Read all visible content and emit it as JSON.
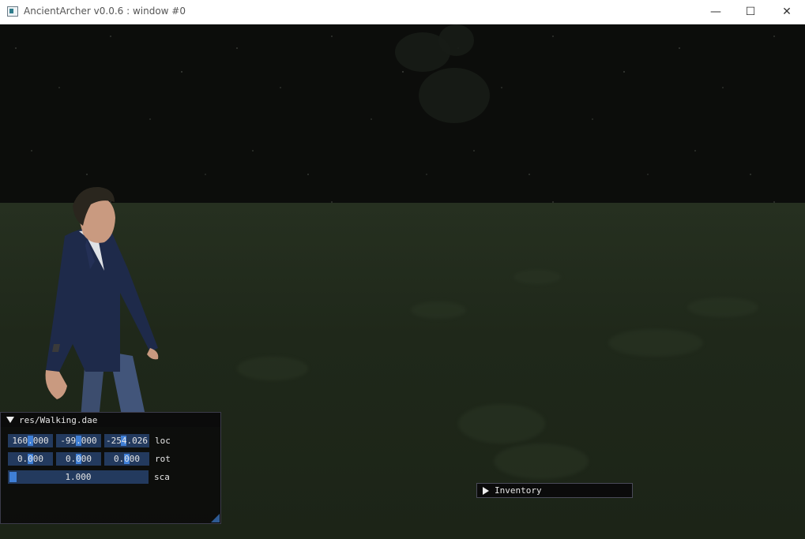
{
  "window": {
    "title": "AncientArcher v0.0.6 : window #0",
    "minimize_glyph": "—",
    "maximize_glyph": "☐",
    "close_glyph": "✕"
  },
  "model_panel": {
    "title": "res/Walking.dae",
    "loc": {
      "label": "loc",
      "x": "160.000",
      "y": "-99.000",
      "z": "-254.026"
    },
    "rot": {
      "label": "rot",
      "x": "0.000",
      "y": "0.000",
      "z": "0.000"
    },
    "sca": {
      "label": "sca",
      "value": "1.000"
    }
  },
  "inventory_panel": {
    "title": "Inventory"
  },
  "colors": {
    "sky": "#0c0d0b",
    "ground": "#1f2719",
    "widget_bg": "#233a5e",
    "grab": "#3f7fd6"
  }
}
